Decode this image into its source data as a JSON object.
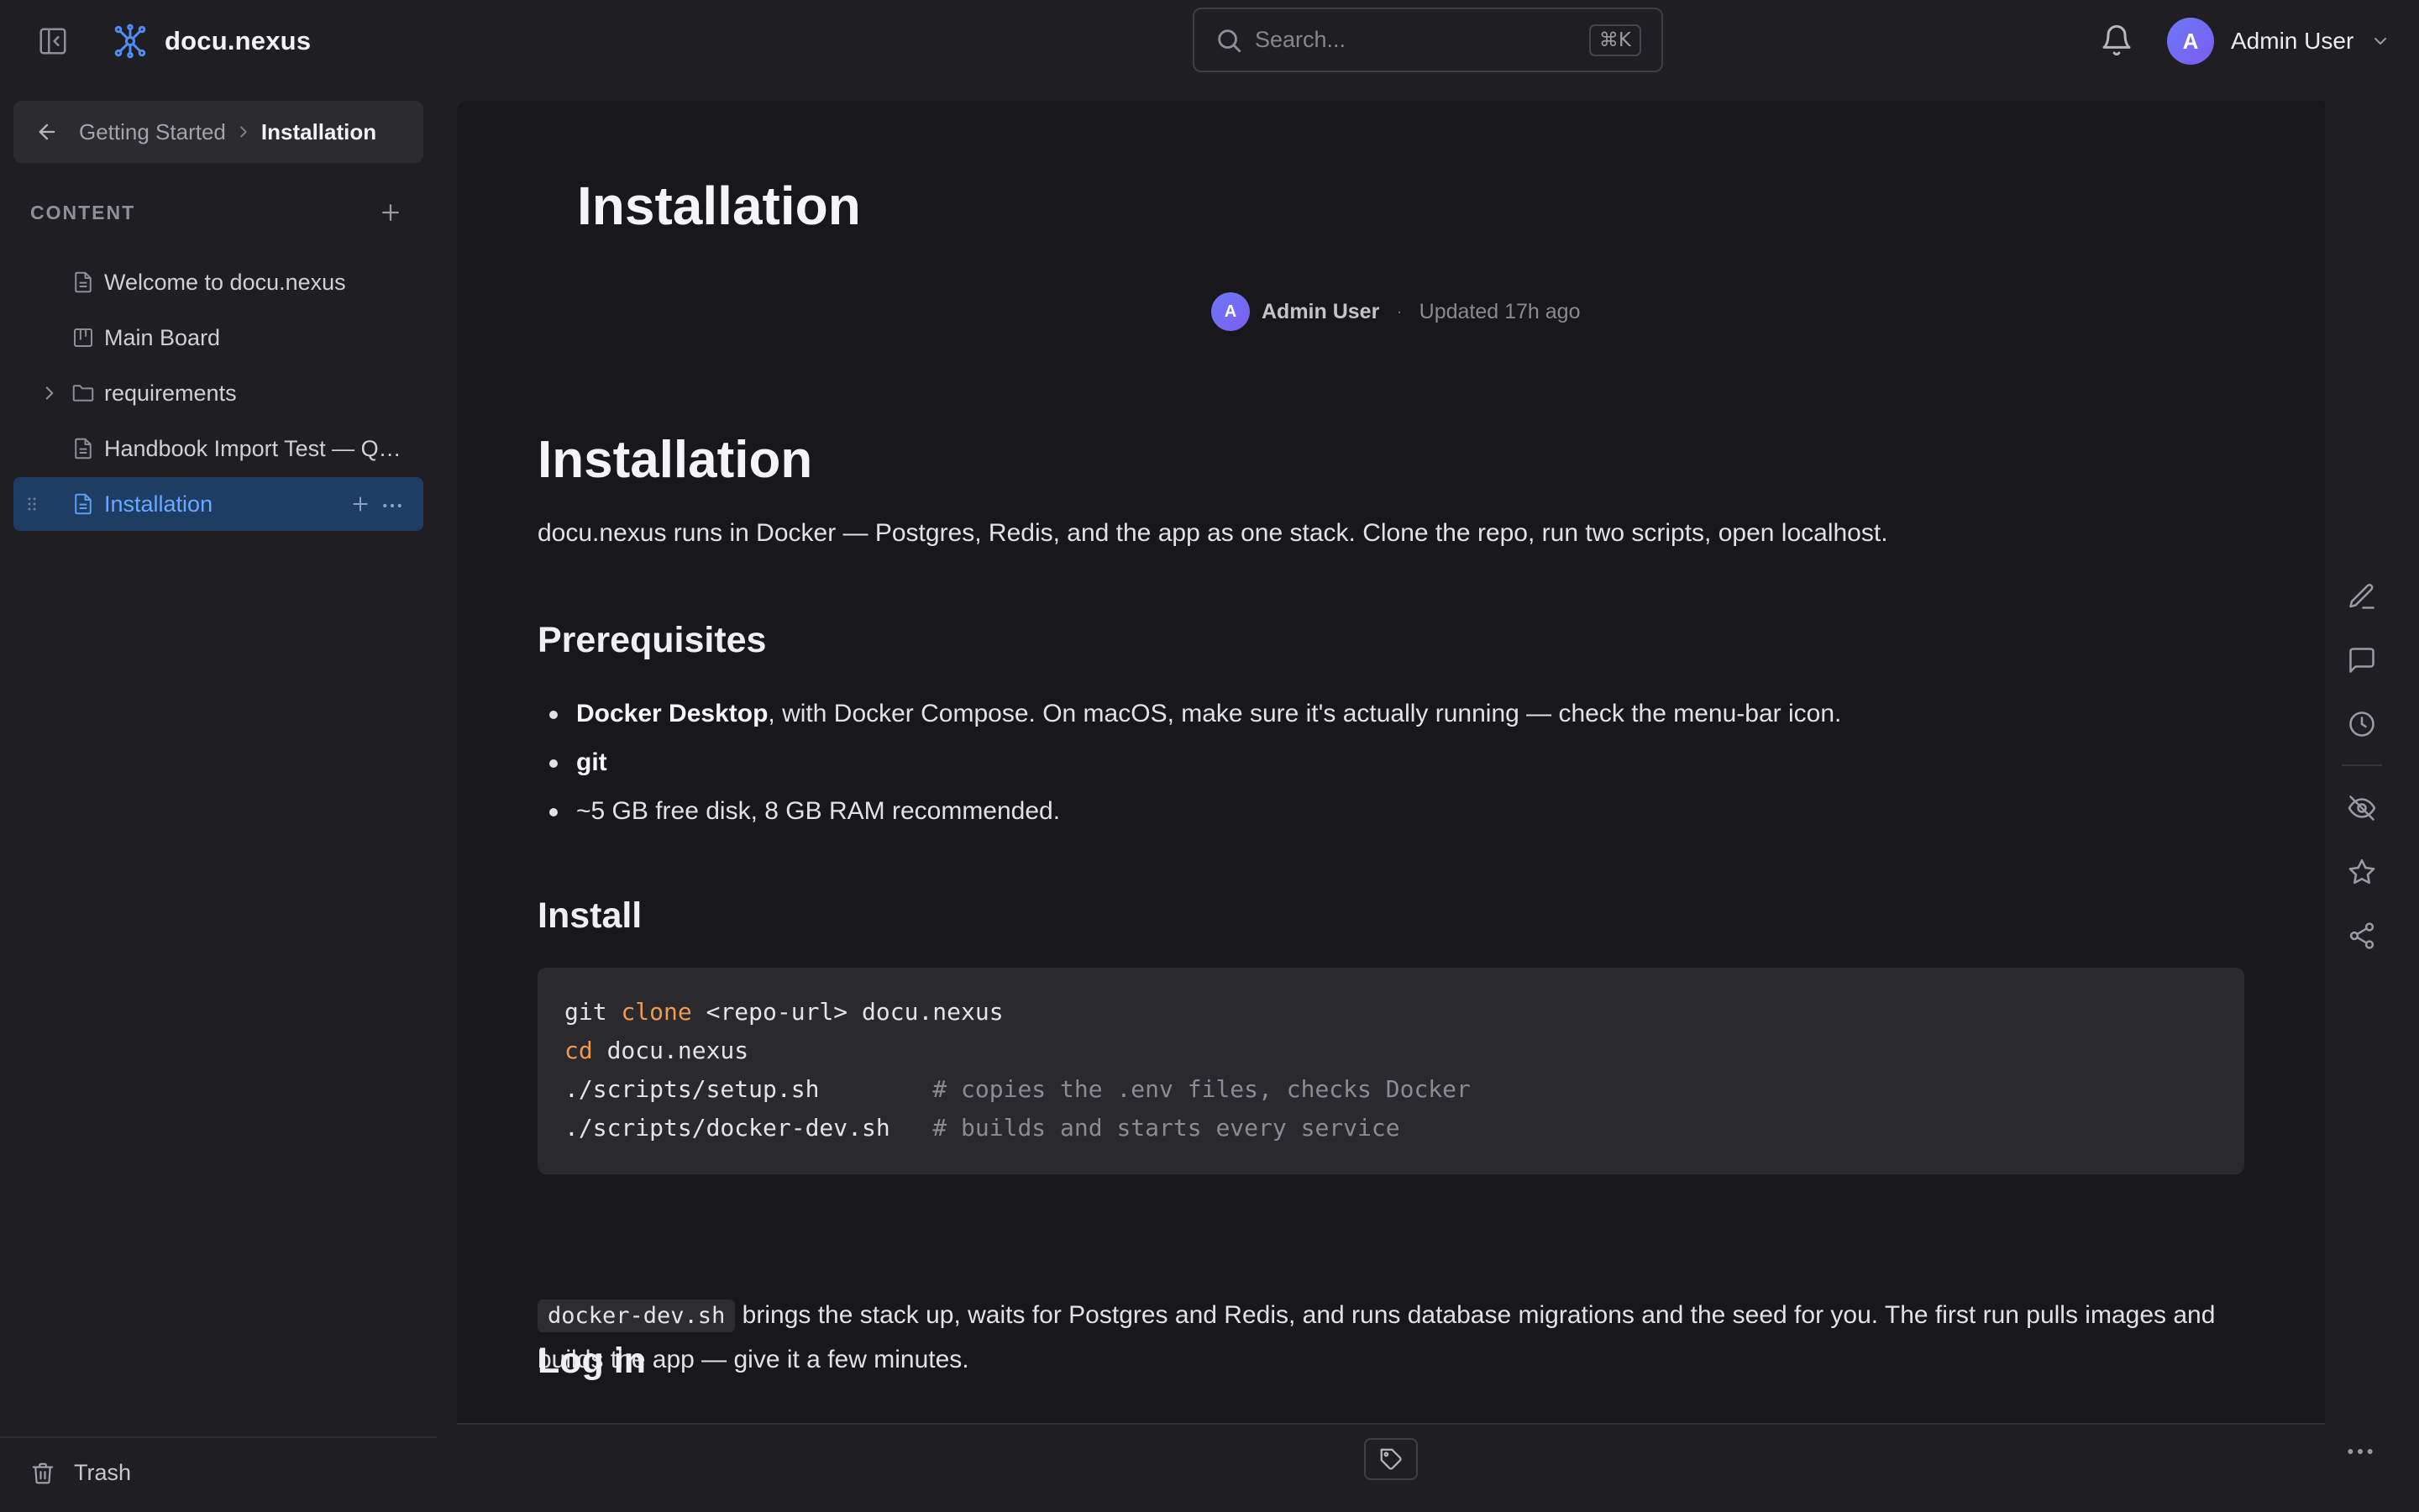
{
  "app": {
    "name": "docu.nexus"
  },
  "header": {
    "search": {
      "placeholder": "Search...",
      "shortcut": "⌘K"
    },
    "user": {
      "initial": "A",
      "name": "Admin User"
    }
  },
  "sidebar": {
    "breadcrumb": {
      "parent": "Getting Started",
      "current": "Installation"
    },
    "section_label": "CONTENT",
    "items": [
      {
        "label": "Welcome to docu.nexus",
        "icon": "document-icon"
      },
      {
        "label": "Main Board",
        "icon": "board-icon"
      },
      {
        "label": "requirements",
        "icon": "folder-icon"
      },
      {
        "label": "Handbook Import Test — Quick Start",
        "icon": "document-icon"
      },
      {
        "label": "Installation",
        "icon": "document-icon",
        "active": true
      }
    ],
    "trash_label": "Trash"
  },
  "document": {
    "title": "Installation",
    "meta": {
      "author_initial": "A",
      "author": "Admin User",
      "separator": "·",
      "updated": "Updated 17h ago"
    },
    "h1": "Installation",
    "intro": "docu.nexus runs in Docker — Postgres, Redis, and the app as one stack. Clone the repo, run two scripts, open localhost.",
    "prereq_heading": "Prerequisites",
    "prereqs": [
      {
        "bold": "Docker Desktop",
        "rest": ", with Docker Compose. On macOS, make sure it's actually running — check the menu-bar icon."
      },
      {
        "bold": "git",
        "rest": ""
      },
      {
        "bold": "",
        "rest": "~5 GB free disk, 8 GB RAM recommended."
      }
    ],
    "install_heading": "Install",
    "code": {
      "line1": {
        "pre": "git ",
        "kw": "clone",
        "post": " <repo-url> docu.nexus"
      },
      "line2": {
        "kw": "cd",
        "post": " docu.nexus"
      },
      "line3": {
        "cmd": "./scripts/setup.sh        ",
        "comment": "# copies the .env files, checks Docker"
      },
      "line4": {
        "cmd": "./scripts/docker-dev.sh   ",
        "comment": "# builds and starts every service"
      }
    },
    "after_code": {
      "inline_code": "docker-dev.sh",
      "text": " brings the stack up, waits for Postgres and Redis, and runs database migrations and the seed for you. The first run pulls images and builds the app — give it a few minutes."
    },
    "login_heading": "Log in"
  },
  "colors": {
    "accent": "#4f8df5",
    "active_row_bg": "#1e3d63",
    "code_keyword": "#f09a4b"
  }
}
